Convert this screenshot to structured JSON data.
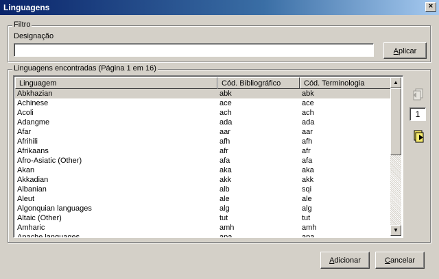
{
  "window": {
    "title": "Linguagens"
  },
  "filter": {
    "group_label": "Filtro",
    "field_label": "Designação",
    "value": "",
    "apply_label": "Aplicar"
  },
  "results": {
    "group_label": "Linguagens encontradas (Página 1 em 16)",
    "columns": [
      "Linguagem",
      "Cód. Bibliográfico",
      "Cód. Terminologia"
    ],
    "rows": [
      [
        "Abkhazian",
        "abk",
        "abk"
      ],
      [
        "Achinese",
        "ace",
        "ace"
      ],
      [
        "Acoli",
        "ach",
        "ach"
      ],
      [
        "Adangme",
        "ada",
        "ada"
      ],
      [
        "Afar",
        "aar",
        "aar"
      ],
      [
        "Afrihili",
        "afh",
        "afh"
      ],
      [
        "Afrikaans",
        "afr",
        "afr"
      ],
      [
        "Afro-Asiatic (Other)",
        "afa",
        "afa"
      ],
      [
        "Akan",
        "aka",
        "aka"
      ],
      [
        "Akkadian",
        "akk",
        "akk"
      ],
      [
        "Albanian",
        "alb",
        "sqi"
      ],
      [
        "Aleut",
        "ale",
        "ale"
      ],
      [
        "Algonquian languages",
        "alg",
        "alg"
      ],
      [
        "Altaic (Other)",
        "tut",
        "tut"
      ],
      [
        "Amharic",
        "amh",
        "amh"
      ],
      [
        "Apache languages",
        "apa",
        "apa"
      ]
    ],
    "selected_index": 0
  },
  "pager": {
    "current_page": "1"
  },
  "footer": {
    "add_label": "Adicionar",
    "cancel_label": "Cancelar"
  },
  "icons": {
    "close": "close-icon",
    "prev": "previous-page-icon",
    "next": "next-page-icon",
    "up": "scroll-up-arrow-icon",
    "down": "scroll-down-arrow-icon"
  },
  "colors": {
    "titlebar": "#0a246a",
    "face": "#d4d0c8",
    "selected_row": "#d4d0c8"
  }
}
